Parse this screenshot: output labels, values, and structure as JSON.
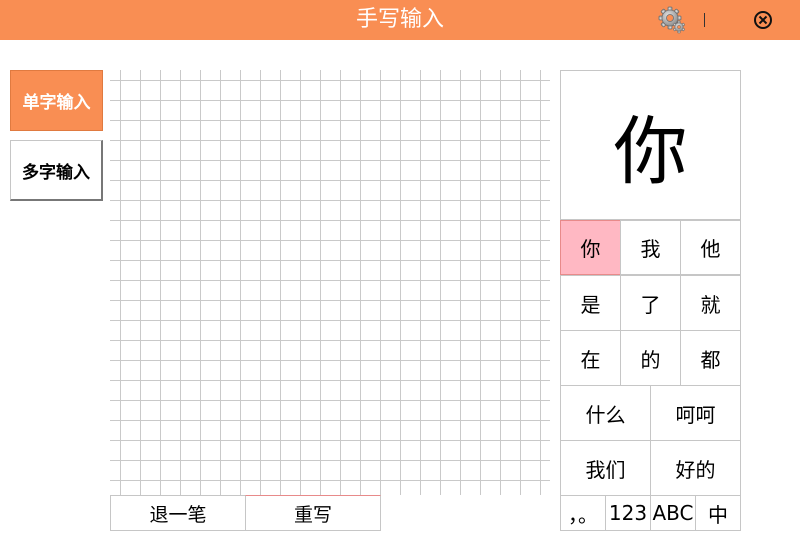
{
  "app": {
    "title": "手写输入"
  },
  "icons": {
    "settings": "gear-icon",
    "close": "close-circle-x-icon"
  },
  "colors": {
    "accent": "#f98e53",
    "selected_candidate": "#ffb8c3",
    "grid_line": "#c9c9c9"
  },
  "modes": {
    "single": "单字输入",
    "multi": "多字输入",
    "active": "single"
  },
  "actions": {
    "undo": "退一笔",
    "rewrite": "重写"
  },
  "preview": {
    "char": "你"
  },
  "candidates": {
    "row1": [
      "你",
      "我",
      "他"
    ],
    "row2": [
      "是",
      "了",
      "就"
    ],
    "row3": [
      "在",
      "的",
      "都"
    ],
    "row4": [
      "什么",
      "呵呵"
    ],
    "row5": [
      "我们",
      "好的"
    ],
    "selected": "你"
  },
  "bottom_bar": {
    "punct": "，。",
    "numbers": "123",
    "letters": "ABC",
    "chinese": "中"
  }
}
